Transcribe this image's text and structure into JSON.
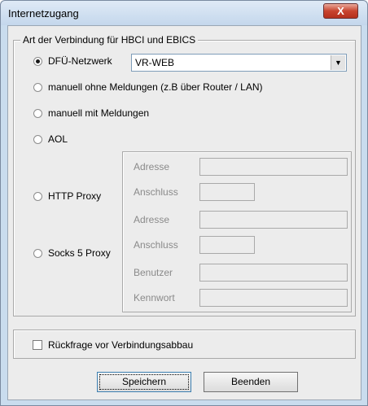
{
  "window": {
    "title": "Internetzugang",
    "close_glyph": "X"
  },
  "group_connection": {
    "legend": "Art der Verbindung für HBCI und EBICS",
    "options": [
      {
        "label": "DFÜ-Netzwerk",
        "selected": true
      },
      {
        "label": "manuell ohne Meldungen (z.B über Router / LAN)",
        "selected": false
      },
      {
        "label": "manuell mit Meldungen",
        "selected": false
      },
      {
        "label": "AOL",
        "selected": false
      },
      {
        "label": "HTTP Proxy",
        "selected": false
      },
      {
        "label": "Socks 5 Proxy",
        "selected": false
      }
    ],
    "dialup": {
      "value": "VR-WEB",
      "arrow": "▼"
    },
    "http_proxy": {
      "address_label": "Adresse",
      "port_label": "Anschluss"
    },
    "socks_proxy": {
      "address_label": "Adresse",
      "port_label": "Anschluss",
      "user_label": "Benutzer",
      "password_label": "Kennwort"
    }
  },
  "confirm": {
    "label": "Rückfrage vor Verbindungsabbau",
    "checked": false
  },
  "buttons": {
    "save": "Speichern",
    "quit": "Beenden"
  }
}
